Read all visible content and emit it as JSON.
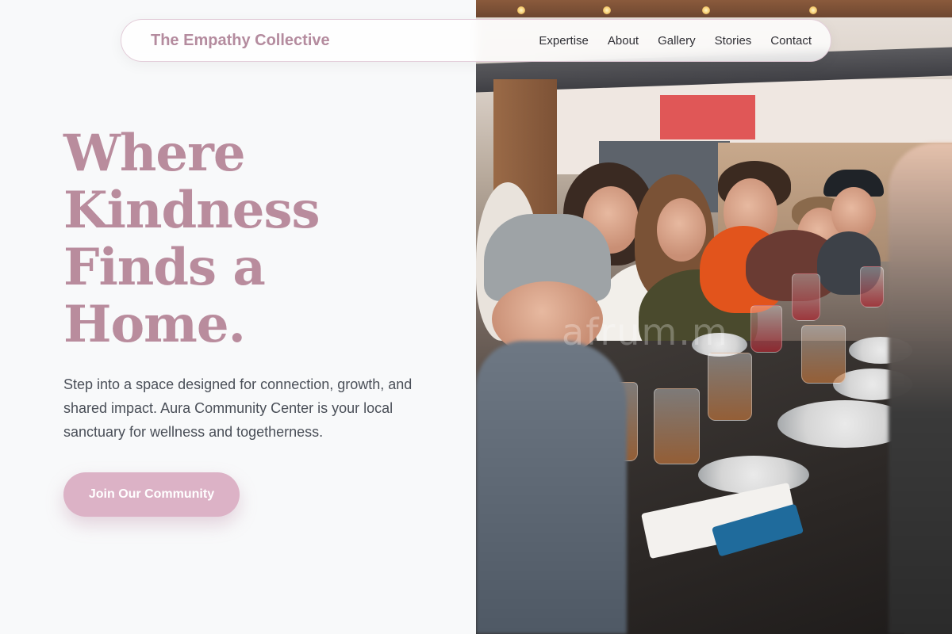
{
  "nav": {
    "brand": "The Empathy Collective",
    "links": [
      "Expertise",
      "About",
      "Gallery",
      "Stories",
      "Contact"
    ]
  },
  "hero": {
    "headline_lines": [
      "Where",
      "Kindness",
      "Finds a",
      "Home."
    ],
    "subtext": "Step into a space designed for connection, growth, and shared impact. Aura Community Center is your local sanctuary for wellness and togetherness.",
    "cta_label": "Join Our Community"
  },
  "photo": {
    "watermark": "afrum.m"
  },
  "colors": {
    "brand": "#b48b9e",
    "headline": "#b98c9d",
    "cta_bg": "#dcb2c6",
    "page_bg": "#f8f9fa",
    "body_text": "#4a4f58"
  }
}
